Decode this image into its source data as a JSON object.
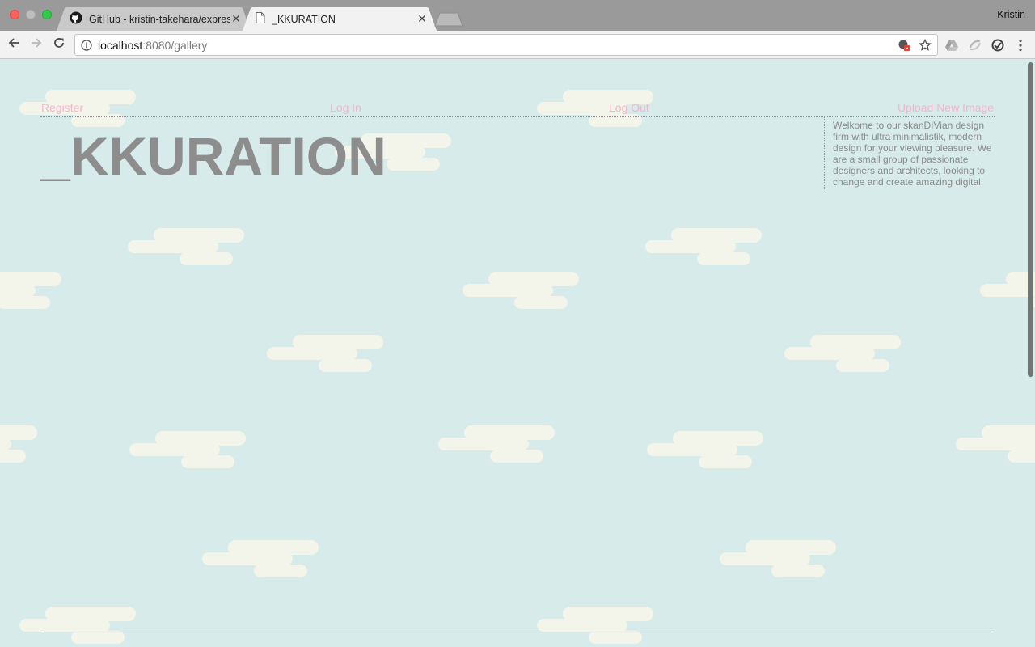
{
  "browser": {
    "tabs": [
      {
        "title": "GitHub - kristin-takehara/express-gallery",
        "icon": "github-icon",
        "active": false
      },
      {
        "title": "_KKURATION",
        "icon": "page-icon",
        "active": true
      }
    ],
    "profile_name": "Kristin",
    "url_host": "localhost",
    "url_rest": ":8080/gallery"
  },
  "page": {
    "nav": {
      "register": "Register",
      "login": "Log In",
      "logout": "Log Out",
      "upload": "Upload New Image"
    },
    "brand": "_KKURATION",
    "intro": "Welkome to our skanDIVian design firm with ultra minimalistik, modern design for your viewing pleasure. We are a small group of passionate designers and architects, looking to change and create amazing digital"
  },
  "colors": {
    "background": "#d6ebea",
    "cloud": "#f3f4ea",
    "link": "#f6b3cc",
    "brand_text": "#8d8d8d"
  }
}
